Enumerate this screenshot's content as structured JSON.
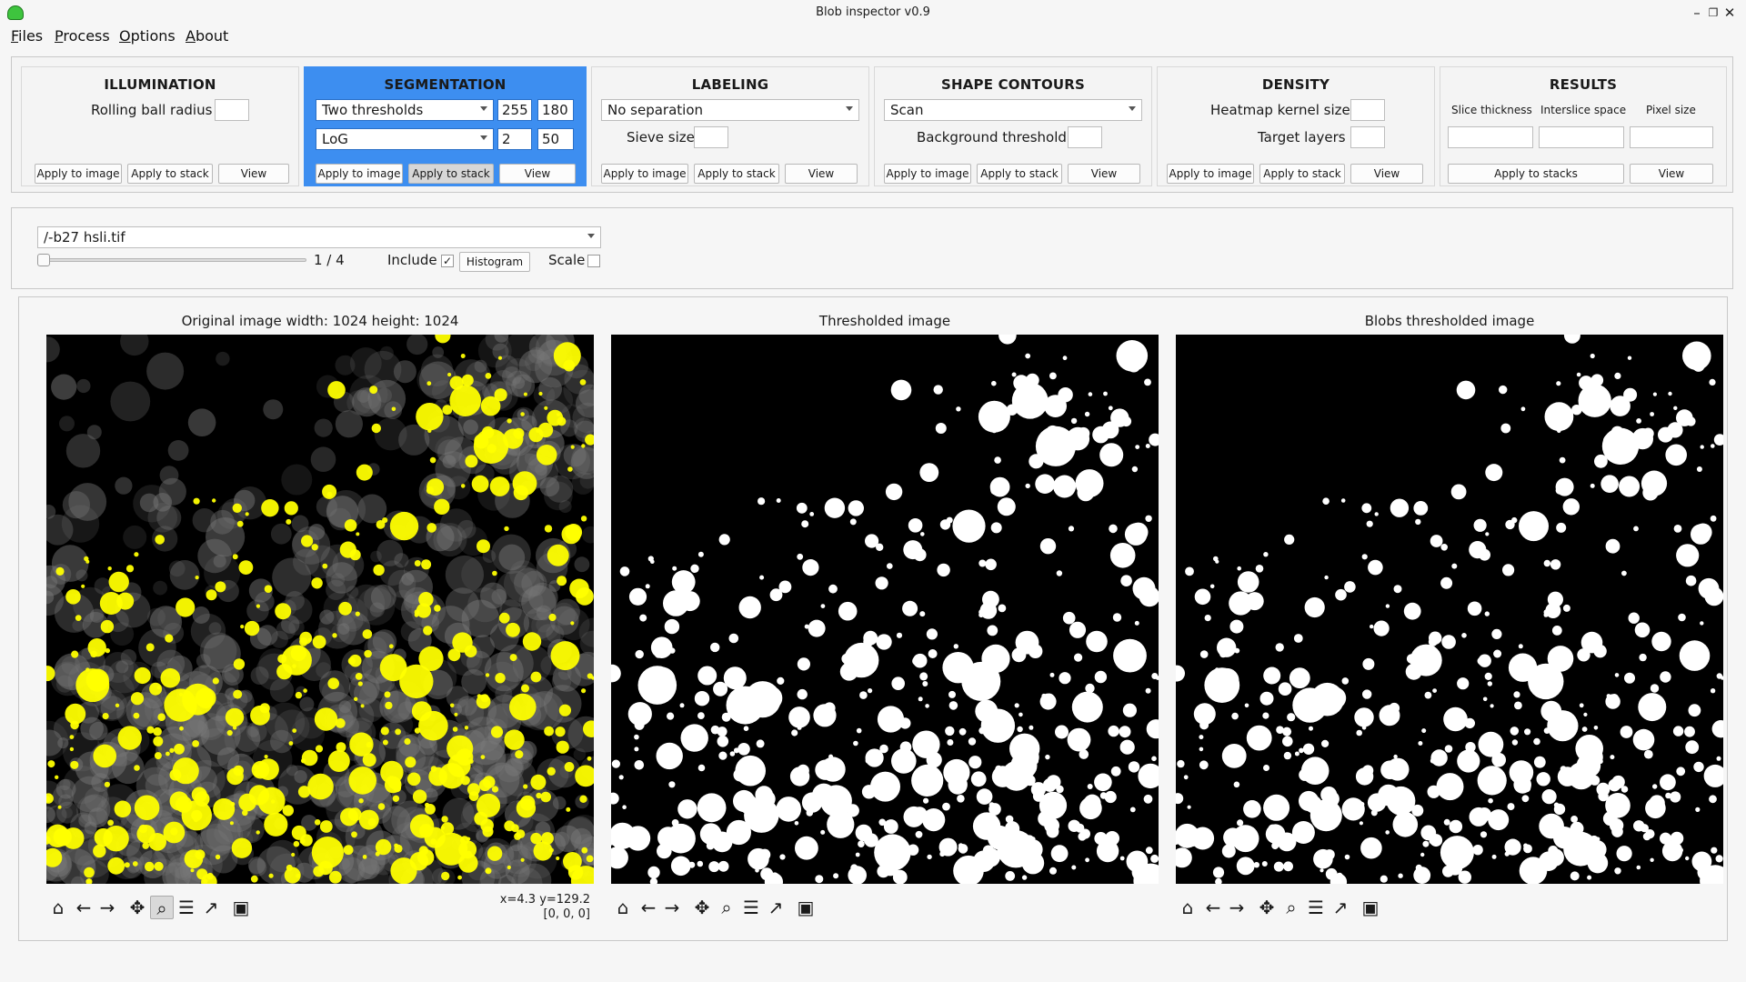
{
  "window": {
    "title": "Blob inspector v0.9"
  },
  "menu": [
    "Files",
    "Process",
    "Options",
    "About"
  ],
  "illumination": {
    "title": "ILLUMINATION",
    "rolling_label": "Rolling ball radius",
    "rolling_value": "",
    "apply_image": "Apply to image",
    "apply_stack": "Apply to stack",
    "view": "View"
  },
  "segmentation": {
    "title": "SEGMENTATION",
    "method1": "Two thresholds",
    "method1_a": "255",
    "method1_b": "180",
    "method2": "LoG",
    "method2_a": "2",
    "method2_b": "50",
    "apply_image": "Apply to image",
    "apply_stack": "Apply to stack",
    "view": "View"
  },
  "labeling": {
    "title": "LABELING",
    "separation": "No separation",
    "sieve_label": "Sieve size",
    "sieve_value": "",
    "apply_image": "Apply to image",
    "apply_stack": "Apply to stack",
    "view": "View"
  },
  "shape_contours": {
    "title": "SHAPE CONTOURS",
    "mode": "Scan",
    "bg_label": "Background threshold",
    "bg_value": "",
    "apply_image": "Apply to image",
    "apply_stack": "Apply to stack",
    "view": "View"
  },
  "density": {
    "title": "DENSITY",
    "heatmap_label": "Heatmap kernel size",
    "heatmap_value": "",
    "target_label": "Target layers",
    "target_value": "",
    "apply_image": "Apply to image",
    "apply_stack": "Apply to stack",
    "view": "View"
  },
  "results": {
    "title": "RESULTS",
    "slice_label": "Slice thickness",
    "interslice_label": "Interslice space",
    "pixel_label": "Pixel size",
    "slice_value": "",
    "interslice_value": "",
    "pixel_value": "",
    "apply_stacks": "Apply to stacks",
    "view": "View"
  },
  "file": {
    "path": "/-b27 hsli.tif",
    "slice_position": 0,
    "counter": "1 / 4",
    "include_label": "Include",
    "include_checked": "✓",
    "histogram": "Histogram",
    "scale_label": "Scale",
    "scale_checked": ""
  },
  "viewer": {
    "original_title": "Original image width: 1024 height: 1024",
    "thresholded_title": "Thresholded image",
    "blobs_title": "Blobs thresholded image",
    "coords_line1": "x=4.3 y=129.2",
    "coords_line2": "[0, 0, 0]",
    "tool_icons": [
      "home-icon",
      "back-icon",
      "forward-icon",
      "pan-icon",
      "zoom-icon",
      "configure-icon",
      "axes-icon",
      "save-icon"
    ]
  },
  "colors": {
    "accent": "#3d8ef0",
    "overlay": "#ffff00",
    "foreground": "#ffffff",
    "background": "#000000"
  }
}
